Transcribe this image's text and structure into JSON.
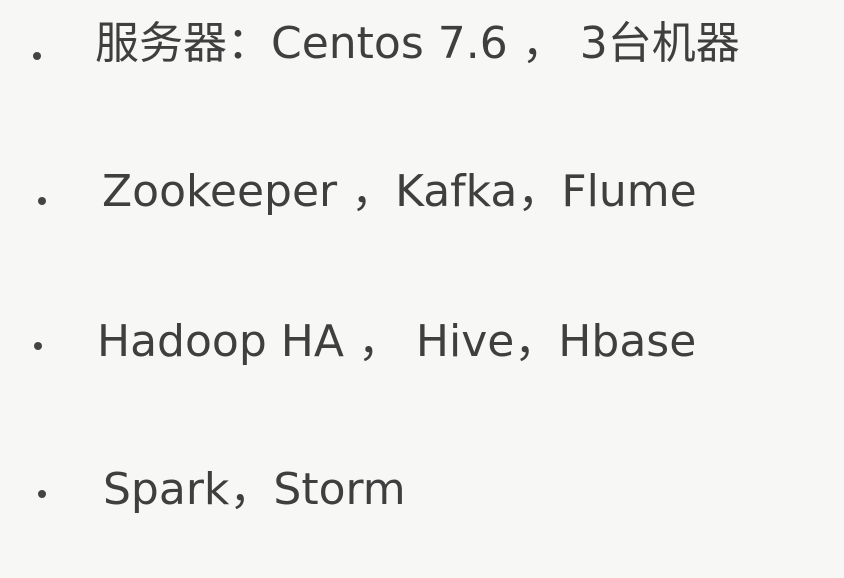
{
  "slide": {
    "bullets": [
      {
        "text": "服务器：Centos 7.6 ， 3台机器"
      },
      {
        "text": "Zookeeper ，Kafka，Flume"
      },
      {
        "text": "Hadoop HA ， Hive，Hbase"
      },
      {
        "text": "Spark，Storm"
      }
    ]
  },
  "colors": {
    "background": "#f7f7f5",
    "text": "#3f3f3f",
    "bullet": "#444444"
  }
}
